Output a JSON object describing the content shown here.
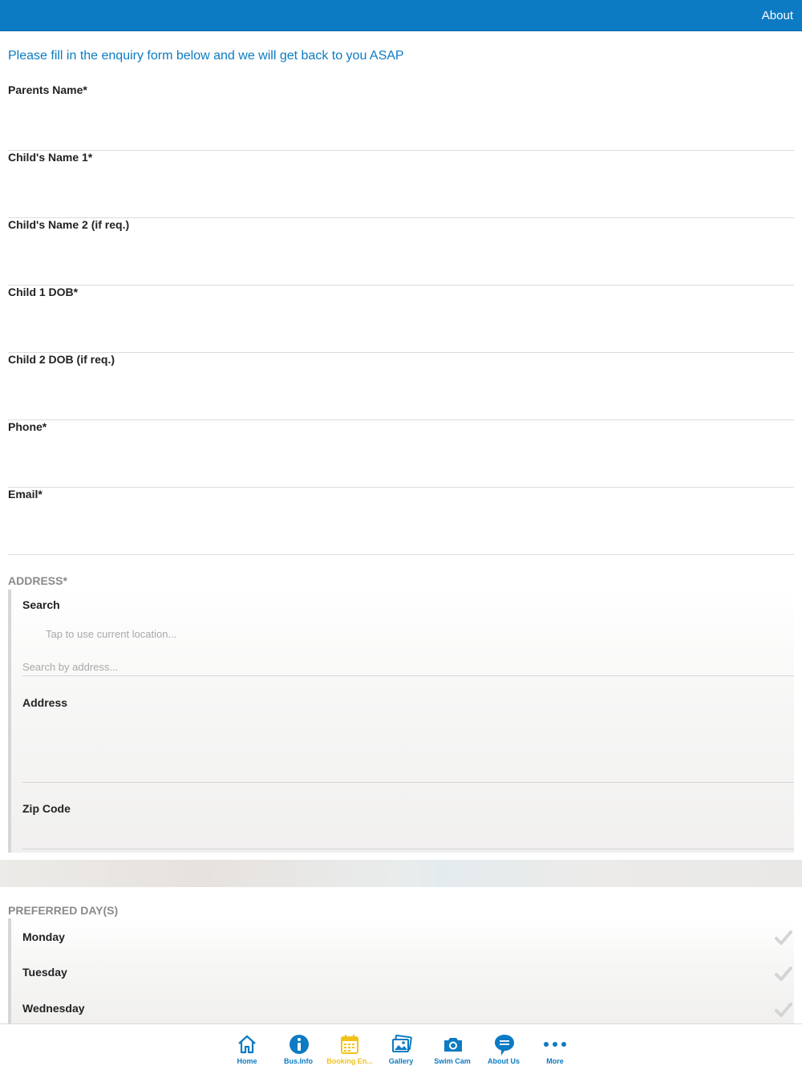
{
  "header": {
    "about_label": "About"
  },
  "intro": "Please fill in the enquiry form below and we will get back to you ASAP",
  "fields": [
    {
      "label": "Parents Name*"
    },
    {
      "label": "Child's Name 1*"
    },
    {
      "label": "Child's Name 2 (if req.)"
    },
    {
      "label": "Child 1 DOB*"
    },
    {
      "label": "Child 2 DOB (if req.)"
    },
    {
      "label": "Phone*"
    },
    {
      "label": "Email*"
    }
  ],
  "address": {
    "title": "ADDRESS*",
    "search_label": "Search",
    "current_location": "Tap to use current location...",
    "search_placeholder": "Search by address...",
    "address_label": "Address",
    "zip_label": "Zip Code"
  },
  "preferred_days": {
    "title": "PREFERRED DAY(S)",
    "days": [
      "Monday",
      "Tuesday",
      "Wednesday"
    ]
  },
  "tabbar": {
    "tabs": [
      {
        "label": "Home",
        "icon": "home-icon"
      },
      {
        "label": "Bus.Info",
        "icon": "info-icon"
      },
      {
        "label": "Booking En...",
        "icon": "calendar-icon",
        "active": true
      },
      {
        "label": "Gallery",
        "icon": "gallery-icon"
      },
      {
        "label": "Swim Cam",
        "icon": "camera-icon"
      },
      {
        "label": "About Us",
        "icon": "chat-bubble-icon"
      },
      {
        "label": "More",
        "icon": "more-dots-icon"
      }
    ],
    "accent": "#0c7bc3",
    "active_color": "#f2c21b"
  },
  "colors": {
    "header_bg": "#0c7bc3",
    "intro_text": "#0c7bc3"
  }
}
